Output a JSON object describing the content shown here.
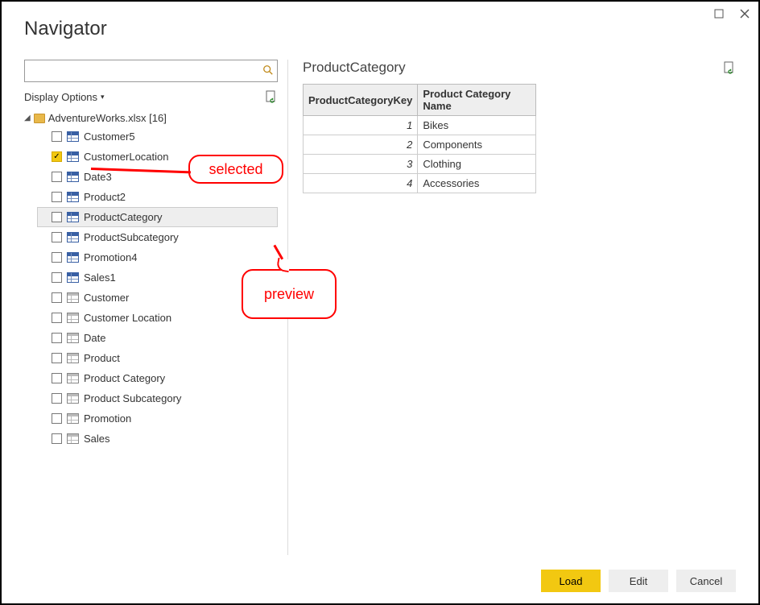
{
  "window": {
    "title": "Navigator",
    "display_options_label": "Display Options"
  },
  "search": {
    "value": "",
    "placeholder": ""
  },
  "tree": {
    "root_label": "AdventureWorks.xlsx [16]",
    "items": [
      {
        "name": "Customer5",
        "checked": false,
        "sheet": false,
        "highlighted": false
      },
      {
        "name": "CustomerLocation",
        "checked": true,
        "sheet": false,
        "highlighted": false
      },
      {
        "name": "Date3",
        "checked": false,
        "sheet": false,
        "highlighted": false
      },
      {
        "name": "Product2",
        "checked": false,
        "sheet": false,
        "highlighted": false
      },
      {
        "name": "ProductCategory",
        "checked": false,
        "sheet": false,
        "highlighted": true
      },
      {
        "name": "ProductSubcategory",
        "checked": false,
        "sheet": false,
        "highlighted": false
      },
      {
        "name": "Promotion4",
        "checked": false,
        "sheet": false,
        "highlighted": false
      },
      {
        "name": "Sales1",
        "checked": false,
        "sheet": false,
        "highlighted": false
      },
      {
        "name": "Customer",
        "checked": false,
        "sheet": true,
        "highlighted": false
      },
      {
        "name": "Customer Location",
        "checked": false,
        "sheet": true,
        "highlighted": false
      },
      {
        "name": "Date",
        "checked": false,
        "sheet": true,
        "highlighted": false
      },
      {
        "name": "Product",
        "checked": false,
        "sheet": true,
        "highlighted": false
      },
      {
        "name": "Product Category",
        "checked": false,
        "sheet": true,
        "highlighted": false
      },
      {
        "name": "Product Subcategory",
        "checked": false,
        "sheet": true,
        "highlighted": false
      },
      {
        "name": "Promotion",
        "checked": false,
        "sheet": true,
        "highlighted": false
      },
      {
        "name": "Sales",
        "checked": false,
        "sheet": true,
        "highlighted": false
      }
    ]
  },
  "preview": {
    "title": "ProductCategory",
    "columns": [
      "ProductCategoryKey",
      "Product Category Name"
    ],
    "rows": [
      {
        "key": "1",
        "name": "Bikes"
      },
      {
        "key": "2",
        "name": "Components"
      },
      {
        "key": "3",
        "name": "Clothing"
      },
      {
        "key": "4",
        "name": "Accessories"
      }
    ]
  },
  "buttons": {
    "load": "Load",
    "edit": "Edit",
    "cancel": "Cancel"
  },
  "annotations": {
    "selected": "selected",
    "preview": "preview"
  }
}
